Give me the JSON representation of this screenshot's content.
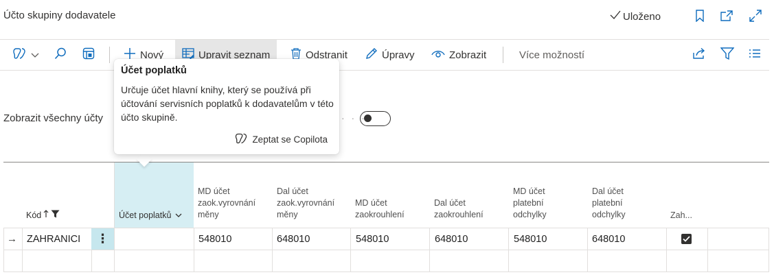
{
  "header": {
    "title": "Účto skupiny dodavatele",
    "saved_label": "Uloženo"
  },
  "toolbar": {
    "new_label": "Nový",
    "edit_list_label": "Upravit seznam",
    "delete_label": "Odstranit",
    "edit_label": "Úpravy",
    "view_label": "Zobrazit",
    "more_label": "Více možností"
  },
  "filter": {
    "show_all_label": "Zobrazit všechny účty",
    "dots": "· · ·"
  },
  "columns": {
    "kod": "Kód",
    "ucet_poplatku": "Účet poplatků",
    "md_zaok_vyrovnani": [
      "MD účet",
      "zaok.vyrovnání",
      "měny"
    ],
    "dal_zaok_vyrovnani": [
      "Dal účet",
      "zaok.vyrovnání",
      "měny"
    ],
    "md_zaokrouhleni": [
      "MD účet",
      "zaokrouhlení"
    ],
    "dal_zaokrouhleni": [
      "Dal účet",
      "zaokrouhlení"
    ],
    "md_platebni": [
      "MD účet",
      "platební",
      "odchylky"
    ],
    "dal_platebni": [
      "Dal účet",
      "platební",
      "odchylky"
    ],
    "zah": "Zah..."
  },
  "rows": [
    {
      "kod": "ZAHRANICI",
      "ucet_poplatku": "",
      "md_zaok_vyrovnani": "548010",
      "dal_zaok_vyrovnani": "648010",
      "md_zaokrouhleni": "548010",
      "dal_zaokrouhleni": "648010",
      "md_platebni": "548010",
      "dal_platebni": "648010",
      "zah_checked": true
    }
  ],
  "tooltip": {
    "title": "Účet poplatků",
    "body": "Určuje účet hlavní knihy, který se používá při účtování servisních poplatků k dodavatelům v této účto skupině.",
    "copilot_label": "Zeptat se Copilota"
  },
  "colors": {
    "accent": "#0f6cbd",
    "column_highlight": "#d6eef3",
    "row_action": "#c6e7ee"
  }
}
